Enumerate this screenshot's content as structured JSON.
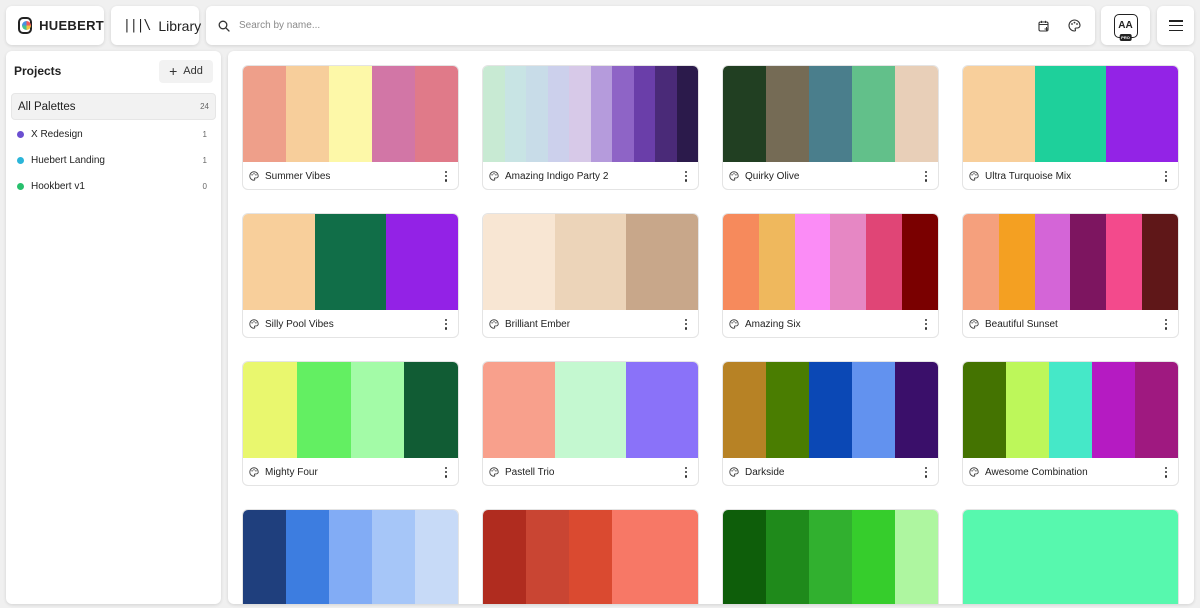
{
  "app": {
    "logo_text": "HUEBERT",
    "library_label": "Library"
  },
  "search": {
    "placeholder": "Search by name...",
    "value": ""
  },
  "account": {
    "badge_text": "AA",
    "badge_sub": "PRO"
  },
  "sidebar": {
    "title": "Projects",
    "add_label": "Add",
    "all": {
      "label": "All Palettes",
      "count": "24"
    },
    "projects": [
      {
        "label": "X Redesign",
        "count": "1",
        "color": "#6b4fd1"
      },
      {
        "label": "Huebert Landing",
        "count": "1",
        "color": "#2bb5d9"
      },
      {
        "label": "Hookbert v1",
        "count": "0",
        "color": "#28c06d"
      }
    ]
  },
  "palettes": [
    {
      "name": "Summer Vibes",
      "colors": [
        "#ee9f8a",
        "#f7ce9b",
        "#fdf8a8",
        "#d276a6",
        "#e07a89"
      ]
    },
    {
      "name": "Amazing Indigo Party 2",
      "colors": [
        "#c8ead3",
        "#c8e4e4",
        "#c8dce8",
        "#ccd0ec",
        "#d7c9e8",
        "#b59bdc",
        "#8e64c6",
        "#6a3ea9",
        "#4a2a78",
        "#2b1a4b"
      ]
    },
    {
      "name": "Quirky Olive",
      "colors": [
        "#213f22",
        "#756b55",
        "#4a7e8c",
        "#62c08a",
        "#e8cfb8"
      ]
    },
    {
      "name": "Ultra Turquoise Mix",
      "colors": [
        "#f8cf9b",
        "#1ed09b",
        "#9323e6"
      ]
    },
    {
      "name": "Silly Pool Vibes",
      "colors": [
        "#f8cf9b",
        "#116e48",
        "#9322e6"
      ]
    },
    {
      "name": "Brilliant Ember",
      "colors": [
        "#f8e6d3",
        "#ecd4b9",
        "#c8a78a"
      ]
    },
    {
      "name": "Amazing Six",
      "colors": [
        "#f68a5c",
        "#efb85d",
        "#fb8cf6",
        "#e687c4",
        "#e04576",
        "#7a0000"
      ]
    },
    {
      "name": "Beautiful Sunset",
      "colors": [
        "#f5a07d",
        "#f4a022",
        "#d465d7",
        "#7d1560",
        "#f34a8c",
        "#5f1718"
      ]
    },
    {
      "name": "Mighty Four",
      "colors": [
        "#e9f76e",
        "#63ef62",
        "#a3fba7",
        "#115c34"
      ]
    },
    {
      "name": "Pastell Trio",
      "colors": [
        "#f8a08c",
        "#c4f8d0",
        "#8a72f9"
      ]
    },
    {
      "name": "Darkside",
      "colors": [
        "#b78225",
        "#4a7d01",
        "#0b48b5",
        "#6292ef",
        "#3a0f6a"
      ]
    },
    {
      "name": "Awesome Combination",
      "colors": [
        "#447301",
        "#bdf75a",
        "#45e8c8",
        "#b51bc2",
        "#9f1980"
      ]
    },
    {
      "name": "",
      "colors": [
        "#1f3f7d",
        "#3d7de0",
        "#82acf5",
        "#a6c6f8",
        "#c7daf7"
      ]
    },
    {
      "name": "",
      "colors": [
        "#b02c1f",
        "#c94533",
        "#da4a30",
        "#f77866",
        "#f77866"
      ]
    },
    {
      "name": "",
      "colors": [
        "#0e5e0a",
        "#1f8a1b",
        "#31b02f",
        "#36cd2c",
        "#aef6a0"
      ]
    },
    {
      "name": "",
      "colors": [
        "#57f8ae"
      ]
    }
  ]
}
